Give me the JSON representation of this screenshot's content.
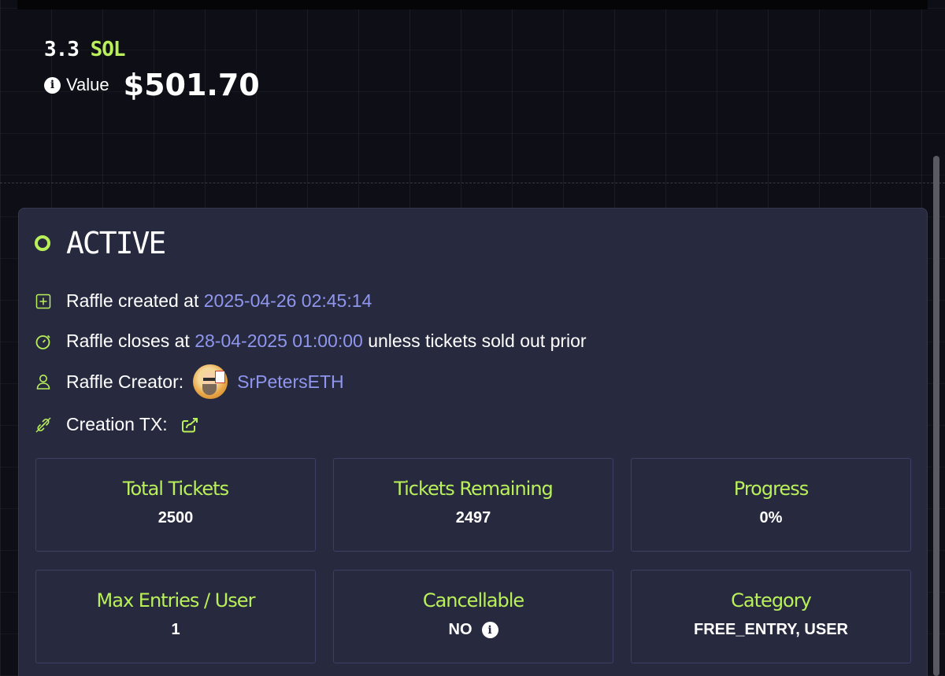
{
  "price": {
    "amount": "3.3",
    "unit": "SOL",
    "value_label": "Value",
    "value_amount": "$501.70"
  },
  "raffle": {
    "status": "ACTIVE",
    "created_label": "Raffle created at",
    "created_at": "2025-04-26 02:45:14",
    "closes_label": "Raffle closes at",
    "closes_at": "28-04-2025 01:00:00",
    "closes_suffix": "unless tickets sold out prior",
    "creator_label": "Raffle Creator:",
    "creator_name": "SrPetersETH",
    "creation_tx_label": "Creation TX:"
  },
  "stats": [
    {
      "label": "Total Tickets",
      "value": "2500"
    },
    {
      "label": "Tickets Remaining",
      "value": "2497"
    },
    {
      "label": "Progress",
      "value": "0%"
    },
    {
      "label": "Max Entries / User",
      "value": "1"
    },
    {
      "label": "Cancellable",
      "value": "NO"
    },
    {
      "label": "Category",
      "value": "FREE_ENTRY, USER"
    }
  ],
  "colors": {
    "accent_green": "#b9f05a",
    "accent_purple": "#8f96ee",
    "card_bg": "#272a3f",
    "page_bg": "#0e0f16"
  },
  "icons": {
    "value_info": "info-icon",
    "status": "status-dot-icon",
    "created": "plus-square-icon",
    "closes": "timer-icon",
    "creator": "user-icon",
    "creation_tx": "link-broken-icon",
    "tx_link": "share-external-icon",
    "cancellable_info": "info-icon"
  }
}
